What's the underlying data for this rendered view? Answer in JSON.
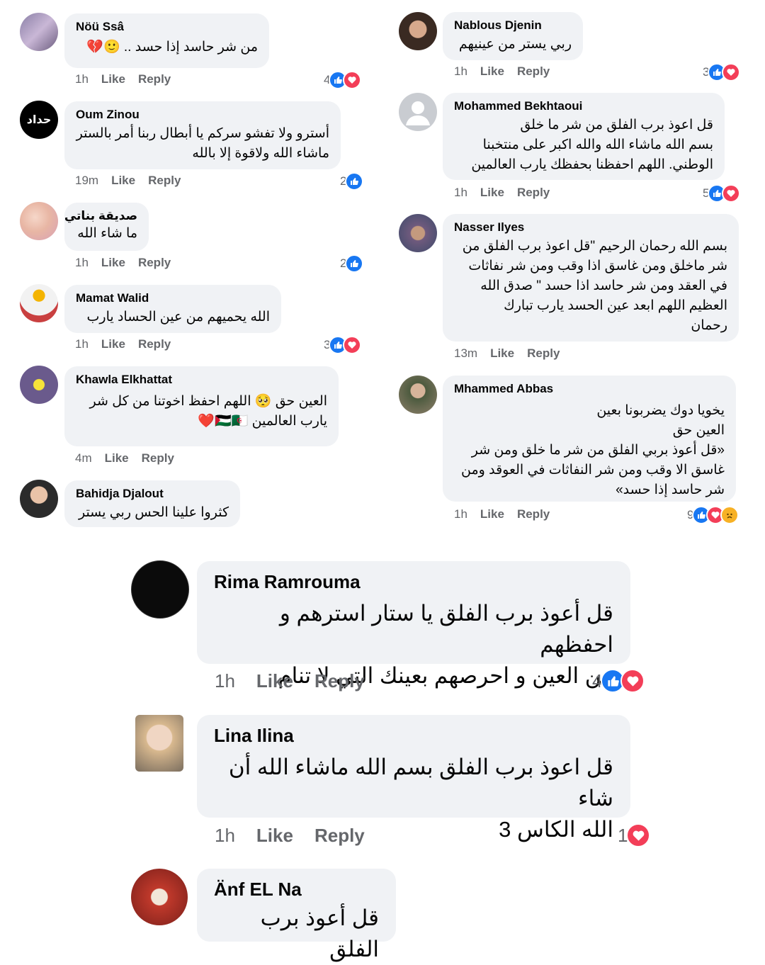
{
  "left_column": [
    {
      "name": "Nöü Ssâ",
      "text": "من شر حاسد إذا حسد .. 🙂💔",
      "time": "1h",
      "like": "Like",
      "reply": "Reply",
      "count": "4",
      "reactions": [
        "like",
        "love"
      ]
    },
    {
      "name": "Oum Zinou",
      "text": "أسترو ولا تفشو سركم يا أبطال ربنا أمر بالستر\nماشاء الله ولاقوة إلا بالله",
      "time": "19m",
      "like": "Like",
      "reply": "Reply",
      "count": "2",
      "reactions": [
        "like"
      ],
      "avatar_text": "حداد"
    },
    {
      "name": "صديقة بناتي",
      "text": "ما شاء الله",
      "time": "1h",
      "like": "Like",
      "reply": "Reply",
      "count": "2",
      "reactions": [
        "like"
      ]
    },
    {
      "name": "Mamat Walid",
      "text": "الله يحميهم من عين الحساد يارب",
      "time": "1h",
      "like": "Like",
      "reply": "Reply",
      "count": "3",
      "reactions": [
        "like",
        "love"
      ]
    },
    {
      "name": "Khawla Elkhattat",
      "text": "العين حق 🥺 اللهم احفظ اخوتنا من كل شر\nيارب العالمين 🇵🇸🇩🇿❤️",
      "time": "4m",
      "like": "Like",
      "reply": "Reply",
      "count": "",
      "reactions": []
    },
    {
      "name": "Bahidja Djalout",
      "text": "كثروا علينا الحس ربي يستر",
      "time": "",
      "like": "",
      "reply": "",
      "count": "",
      "reactions": []
    }
  ],
  "right_column": [
    {
      "name": "Nablous Djenin",
      "text": "ربي يستر من عينيهم",
      "time": "1h",
      "like": "Like",
      "reply": "Reply",
      "count": "3",
      "reactions": [
        "like",
        "love"
      ]
    },
    {
      "name": "Mohammed Bekhtaoui",
      "text": "قل اعوذ برب الفلق من شر ما خلق\nبسم الله ماشاء الله والله اكبر على منتخبنا\nالوطني.  اللهم احفظنا بحفظك يارب العالمين",
      "time": "1h",
      "like": "Like",
      "reply": "Reply",
      "count": "5",
      "reactions": [
        "like",
        "love"
      ]
    },
    {
      "name": "Nasser Ilyes",
      "text": "بسم الله رحمان الرحيم \"قل اعوذ برب الفلق من\nشر ماخلق ومن غاسق اذا وقب ومن شر نفاثات\nفي العقد ومن شر حاسد اذا حسد \" صدق الله\nالعظيم اللهم ابعد عين الحسد يارب تبارك\nرحمان",
      "time": "13m",
      "like": "Like",
      "reply": "Reply",
      "count": "",
      "reactions": []
    },
    {
      "name": "Mhammed Abbas",
      "text": "يخويا دوك يضربونا بعين\nالعين حق\n«قل أعوذ بربي الفلق من شر ما خلق ومن شر\nغاسق الا وقب ومن شر النفاثات في العوقد ومن\nشر حاسد إذا حسد»",
      "time": "1h",
      "like": "Like",
      "reply": "Reply",
      "count": "9",
      "reactions": [
        "like",
        "love",
        "sad"
      ]
    }
  ],
  "bottom_section": [
    {
      "name": "Rima Ramrouma",
      "text": "قل أعوذ برب الفلق يا ستار استرهم و احفظهم\nمن العين و احرصهم بعينك التي لا تنام",
      "time": "1h",
      "like": "Like",
      "reply": "Reply",
      "count": "4",
      "reactions": [
        "like",
        "love"
      ]
    },
    {
      "name": "Lina Ilina",
      "text": "قل اعوذ برب الفلق بسم الله ماشاء الله أن شاء\nالله الكاس 3",
      "time": "1h",
      "like": "Like",
      "reply": "Reply",
      "count": "1",
      "reactions": [
        "love"
      ]
    },
    {
      "name": "Änf EL Na",
      "text": "قل أعوذ برب الفلق",
      "time": "",
      "like": "",
      "reply": "",
      "count": "",
      "reactions": []
    }
  ],
  "colors": {
    "bubble": "#f0f2f5",
    "meta": "#65676b",
    "like": "#1877f2",
    "love": "#f33e58",
    "sad": "#f7b125"
  }
}
